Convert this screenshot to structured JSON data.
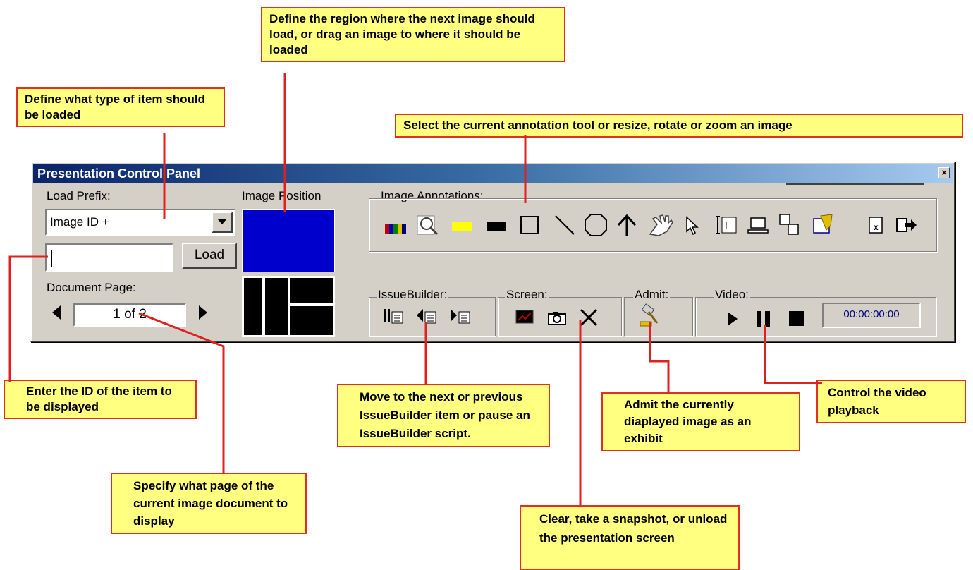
{
  "window": {
    "title": "Presentation Control Panel"
  },
  "load": {
    "prefix_label": "Load Prefix:",
    "prefix_value": "Image ID +",
    "id_value": "",
    "load_button": "Load"
  },
  "document": {
    "page_label": "Document Page:",
    "page_value": "1 of 2"
  },
  "image_position": {
    "label": "Image Position"
  },
  "annotations": {
    "label": "Image Annotations:"
  },
  "issuebuilder": {
    "label": "IssueBuilder:"
  },
  "screen": {
    "label": "Screen:"
  },
  "admit": {
    "label": "Admit:"
  },
  "video": {
    "label": "Video:",
    "timecode": "00:00:00:00"
  },
  "callouts": {
    "region": "Define the region where the next image should load, or drag an image to where it should be loaded",
    "item_type": "Define what type of item should be loaded",
    "annotation": "Select the current annotation tool or resize, rotate or zoom an image",
    "enter_id": "Enter the ID of the item to be displayed",
    "issuebuilder": "Move to the next or previous IssueBuilder item or pause an IssueBuilder script.",
    "admit": "Admit the currently diaplayed image as an exhibit",
    "video": "Control the video playback",
    "page": "Specify what page of the current image document to display",
    "screen": "Clear, take a snapshot, or unload the presentation screen"
  },
  "colors": {
    "callout_bg": "#ffff80",
    "callout_border": "#e03020",
    "leader": "#e02020",
    "title_start": "#0a246a",
    "title_end": "#a6caf0",
    "position_selected": "#0000cc"
  }
}
